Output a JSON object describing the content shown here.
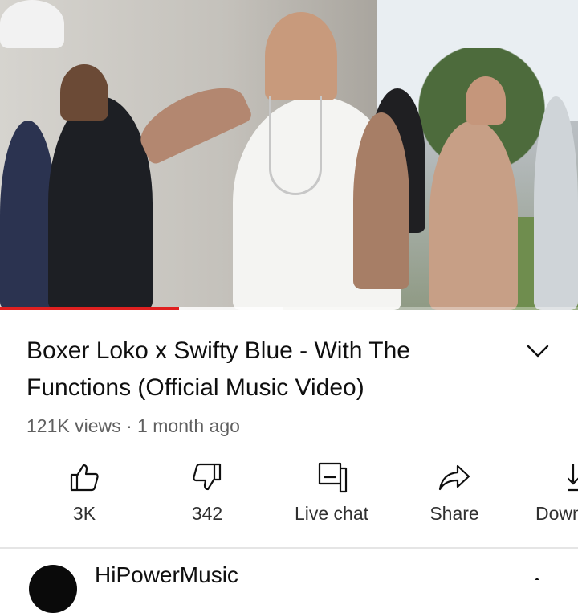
{
  "video": {
    "progress": 0.31,
    "buffered": 0.49,
    "colors": {
      "progress": "#e02020"
    }
  },
  "info": {
    "title": "Boxer Loko x Swifty Blue - With The Functions (Official Music Video)",
    "meta": "121K views · 1 month ago"
  },
  "actions": [
    {
      "icon": "thumbs-up-icon",
      "label": "3K"
    },
    {
      "icon": "thumbs-down-icon",
      "label": "342"
    },
    {
      "icon": "live-chat-icon",
      "label": "Live chat"
    },
    {
      "icon": "share-icon",
      "label": "Share"
    },
    {
      "icon": "download-icon",
      "label": "Download"
    }
  ],
  "channel": {
    "name": "HiPowerMusic"
  }
}
